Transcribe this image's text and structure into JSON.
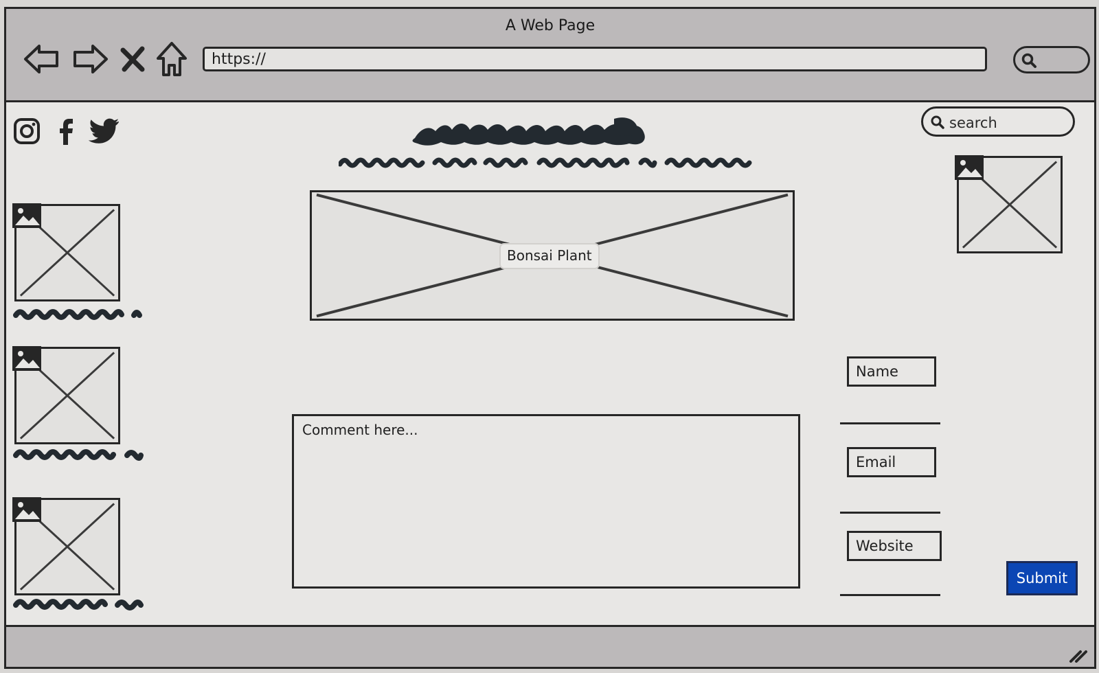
{
  "window": {
    "title": "A Web Page"
  },
  "toolbar": {
    "back_icon": "back-arrow-icon",
    "forward_icon": "forward-arrow-icon",
    "stop_icon": "close-icon",
    "home_icon": "home-icon",
    "url": "https://",
    "search_icon": "search-icon"
  },
  "social": [
    {
      "icon": "instagram-icon"
    },
    {
      "icon": "facebook-icon"
    },
    {
      "icon": "twitter-icon"
    }
  ],
  "header": {
    "logo": "illegible-scribble",
    "tagline": "illegible-scribble"
  },
  "search": {
    "placeholder": "search"
  },
  "hero": {
    "label": "Bonsai Plant"
  },
  "sidebar": {
    "items": [
      {
        "image": "image-placeholder",
        "caption": "illegible-scribble"
      },
      {
        "image": "image-placeholder",
        "caption": "illegible-scribble"
      },
      {
        "image": "image-placeholder",
        "caption": "illegible-scribble"
      }
    ]
  },
  "comment": {
    "placeholder": "Comment here..."
  },
  "form": {
    "name_label": "Name",
    "email_label": "Email",
    "website_label": "Website",
    "submit_label": "Submit"
  },
  "colors": {
    "frame": "#262626",
    "chrome": "#bcb9ba",
    "canvas": "#e8e7e5",
    "submit": "#0b46b4"
  }
}
